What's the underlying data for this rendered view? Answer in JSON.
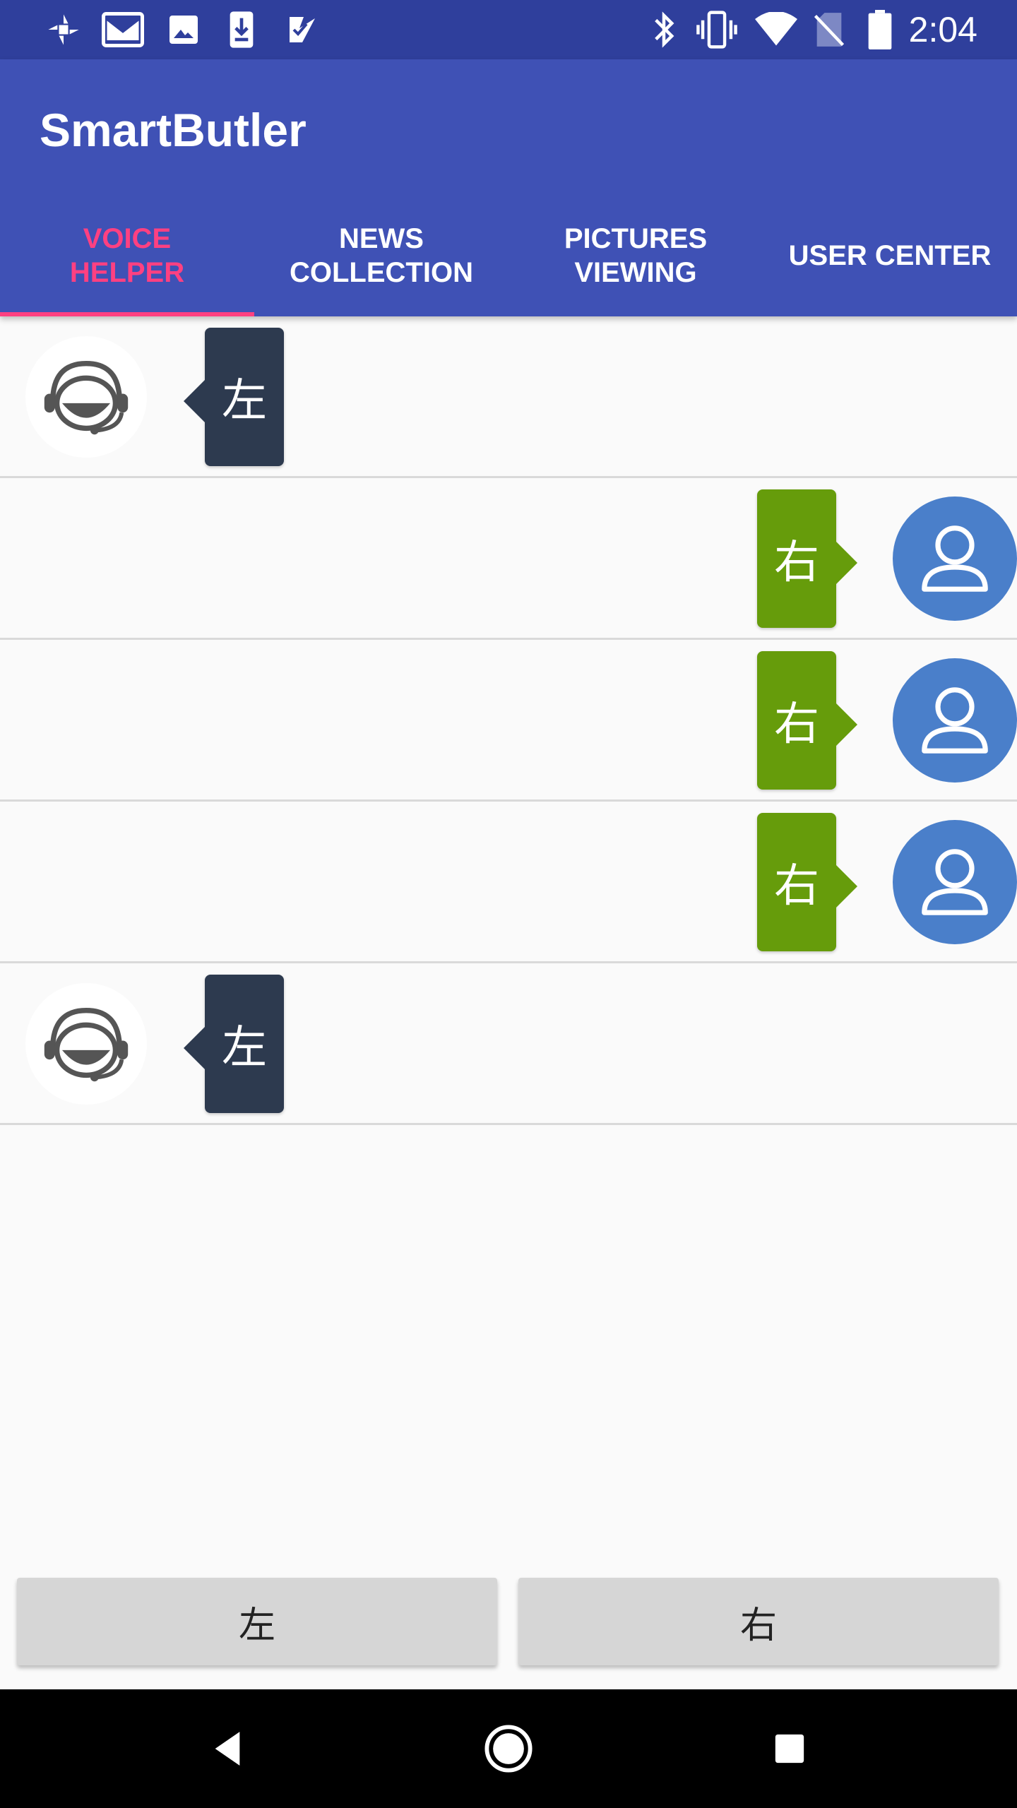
{
  "status_bar": {
    "time": "2:04",
    "left_icons": [
      "pinwheel-icon",
      "gmail-icon",
      "image-icon",
      "download-icon",
      "check-icon"
    ],
    "right_icons": [
      "bluetooth-icon",
      "vibrate-icon",
      "wifi-icon",
      "no-sim-icon",
      "battery-icon"
    ]
  },
  "app_bar": {
    "title": "SmartButler",
    "background": "#3f51b5",
    "accent": "#ff4081",
    "tabs": [
      {
        "label": "VOICE\nHELPER",
        "active": true
      },
      {
        "label": "NEWS\nCOLLECTION",
        "active": false
      },
      {
        "label": "PICTURES\nVIEWING",
        "active": false
      },
      {
        "label": "USER CENTER",
        "active": false
      }
    ]
  },
  "chat": {
    "messages": [
      {
        "side": "left",
        "text": "左",
        "avatar": "headset-icon"
      },
      {
        "side": "right",
        "text": "右",
        "avatar": "user-icon"
      },
      {
        "side": "right",
        "text": "右",
        "avatar": "user-icon"
      },
      {
        "side": "right",
        "text": "右",
        "avatar": "user-icon"
      },
      {
        "side": "left",
        "text": "左",
        "avatar": "headset-icon"
      }
    ],
    "left_bubble_color": "#2d3a4f",
    "right_bubble_color": "#669c0b",
    "user_avatar_color": "#4a7fca"
  },
  "buttons": {
    "left_label": "左",
    "right_label": "右"
  },
  "nav_bar": {
    "icons": [
      "back-icon",
      "home-icon",
      "recents-icon"
    ]
  }
}
